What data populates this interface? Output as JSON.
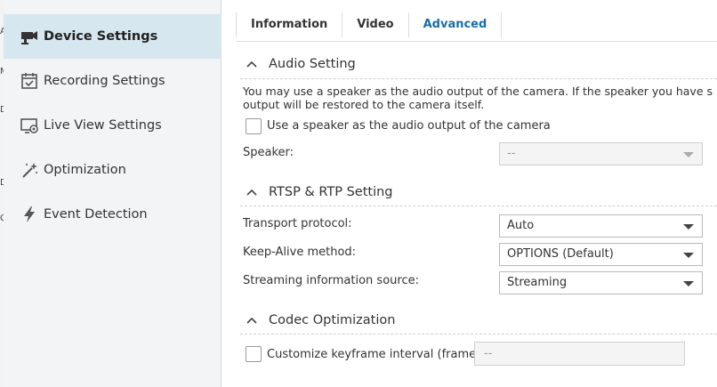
{
  "gutter_letters": [
    "A",
    "M",
    "D",
    "D",
    "C"
  ],
  "sidebar": {
    "items": [
      {
        "label": "Device Settings",
        "icon": "camera-icon"
      },
      {
        "label": "Recording Settings",
        "icon": "calendar-check-icon"
      },
      {
        "label": "Live View Settings",
        "icon": "monitor-camera-icon"
      },
      {
        "label": "Optimization",
        "icon": "magic-wand-icon"
      },
      {
        "label": "Event Detection",
        "icon": "lightning-icon"
      }
    ]
  },
  "tabs": [
    {
      "label": "Information"
    },
    {
      "label": "Video"
    },
    {
      "label": "Advanced"
    }
  ],
  "audio": {
    "title": "Audio Setting",
    "description_line1": "You may use a speaker as the audio output of the camera. If the speaker you have s",
    "description_line2": "output will be restored to the camera itself.",
    "checkbox_label": "Use a speaker as the audio output of the camera",
    "speaker_label": "Speaker:",
    "speaker_value": "--"
  },
  "rtsp": {
    "title": "RTSP & RTP Setting",
    "transport_label": "Transport protocol:",
    "transport_value": "Auto",
    "keepalive_label": "Keep-Alive method:",
    "keepalive_value": "OPTIONS (Default)",
    "source_label": "Streaming information source:",
    "source_value": "Streaming"
  },
  "codec": {
    "title": "Codec Optimization",
    "checkbox_label": "Customize keyframe interval (frame)",
    "interval_value": "--"
  },
  "colors": {
    "active_tab": "#1a6ea8",
    "sidebar_active": "#d7e7f0",
    "sidebar_bg": "#f3f4f5"
  }
}
